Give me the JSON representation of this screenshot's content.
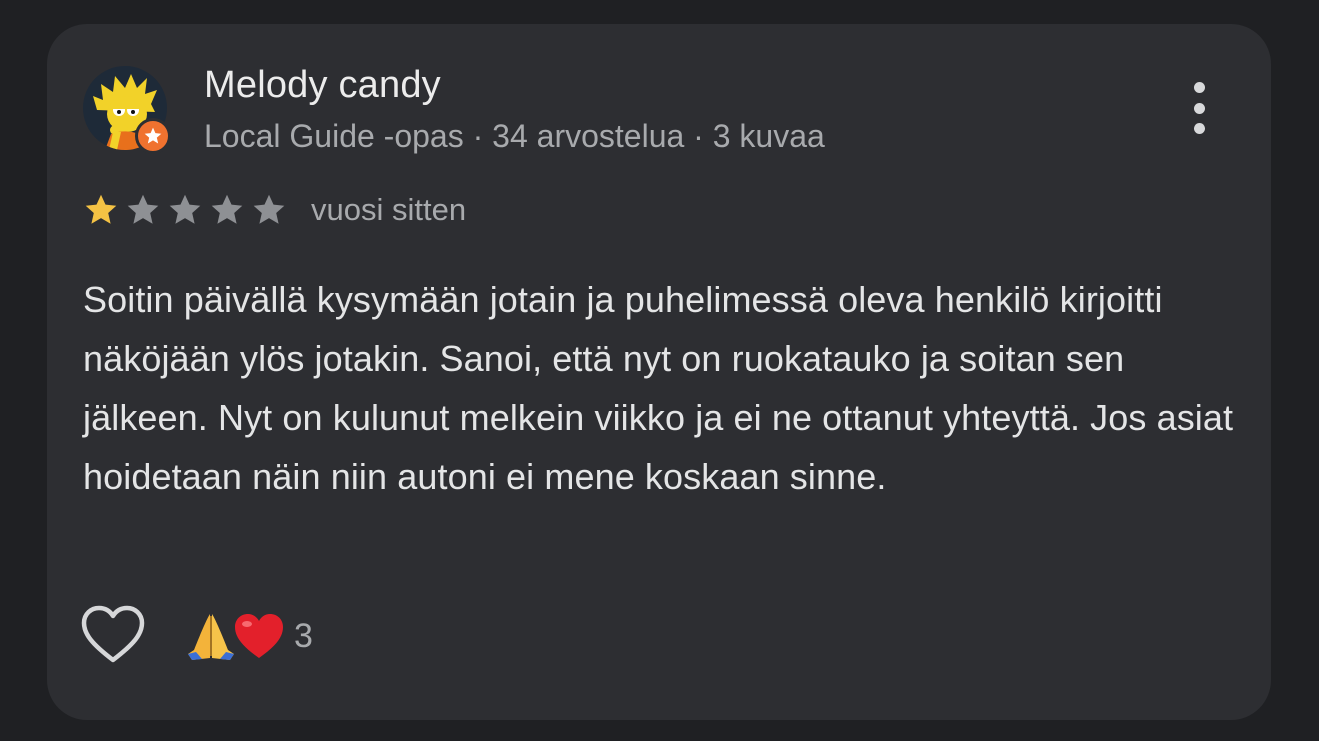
{
  "review": {
    "author": {
      "name": "Melody candy",
      "meta": "Local Guide -opas · 34 arvostelua · 3 kuvaa",
      "avatar_icon": "cartoon-girl-avatar",
      "badge_icon": "local-guide-star-badge",
      "badge_color": "#f0722f"
    },
    "rating": {
      "value": 1,
      "max": 5,
      "filled_color": "#f4c244",
      "empty_color": "#8e9094"
    },
    "time": "vuosi sitten",
    "text": "Soitin päivällä kysymään jotain ja puhelimessä oleva henkilö kirjoitti näköjään ylös jotakin. Sanoi, että nyt on ruokatauko ja soitan sen jälkeen. Nyt on kulunut melkein viikko ja ei ne ottanut yhteyttä. Jos asiat hoidetaan näin niin autoni ei mene koskaan sinne.",
    "actions": {
      "like_icon": "heart-outline-icon",
      "more_icon": "more-vertical-icon"
    },
    "reactions": {
      "icons": [
        "folded-hands-icon",
        "red-heart-icon"
      ],
      "count": "3"
    }
  },
  "colors": {
    "page_background": "#1f2023",
    "card_background": "#2d2e32",
    "primary_text": "#ececec",
    "secondary_text": "#a8aaad"
  }
}
